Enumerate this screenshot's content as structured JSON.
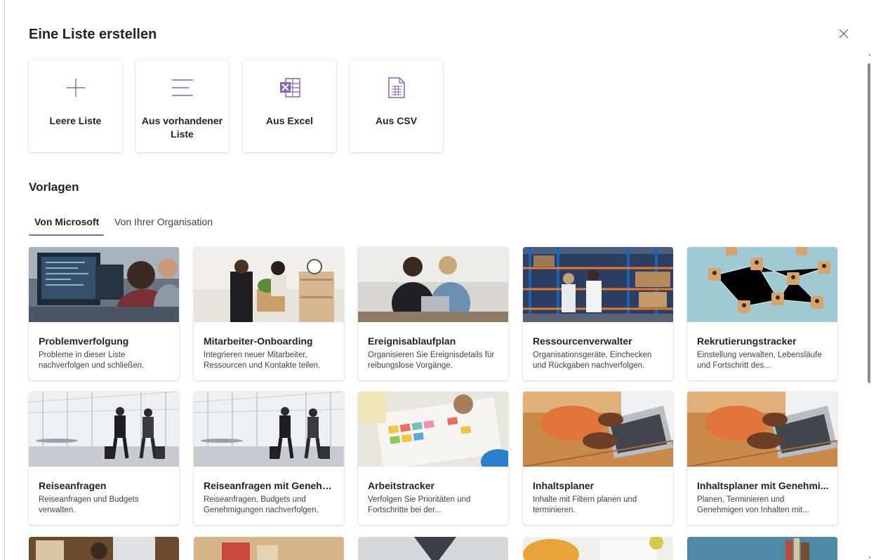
{
  "dialog": {
    "title": "Eine Liste erstellen",
    "close_icon": "close-icon"
  },
  "create_options": [
    {
      "label": "Leere Liste",
      "icon": "plus-icon"
    },
    {
      "label": "Aus vorhandener Liste",
      "icon": "list-lines-icon"
    },
    {
      "label": "Aus Excel",
      "icon": "excel-icon"
    },
    {
      "label": "Aus CSV",
      "icon": "csv-file-icon"
    }
  ],
  "templates": {
    "title": "Vorlagen",
    "tabs": [
      {
        "label": "Von Microsoft",
        "active": true
      },
      {
        "label": "Von Ihrer Organisation",
        "active": false
      }
    ],
    "cards": [
      {
        "title": "Problemverfolgung",
        "desc": "Probleme in dieser Liste nachverfolgen und schließen.",
        "image": "office-desk-monitors-photo"
      },
      {
        "title": "Mitarbeiter-Onboarding",
        "desc": "Integrieren neuer Mitarbeiter, Ressourcen und Kontakte teilen.",
        "image": "handshake-new-employee-photo"
      },
      {
        "title": "Ereignisablaufplan",
        "desc": "Organisieren Sie Ereignisdetails für reibungslose Vorgänge.",
        "image": "two-women-laptop-photo"
      },
      {
        "title": "Ressourcenverwalter",
        "desc": "Organisationsgeräte, Einchecken und Rückgaben nachverfolgen.",
        "image": "warehouse-shelves-photo"
      },
      {
        "title": "Rekrutierungstracker",
        "desc": "Einstellung verwalten, Lebensläufe und Fortschritt des...",
        "image": "network-blocks-photo"
      },
      {
        "title": "Reiseanfragen",
        "desc": "Reiseanfragen und Budgets verwalten.",
        "image": "airport-travelers-photo"
      },
      {
        "title": "Reiseanfragen mit Genehm...",
        "desc": "Reiseanfragen, Budgets und Genehmigungen nachverfolgen.",
        "image": "airport-travelers-photo"
      },
      {
        "title": "Arbeitstracker",
        "desc": "Verfolgen Sie Prioritäten und Fortschritte bei der...",
        "image": "sticky-notes-chart-photo"
      },
      {
        "title": "Inhaltsplaner",
        "desc": "Inhalte mit Filtern planen und terminieren.",
        "image": "hands-laptop-photo"
      },
      {
        "title": "Inhaltsplaner mit Genehmi...",
        "desc": "Planen, Terminieren und Genehmigen von Inhalten mit...",
        "image": "hands-laptop-photo"
      }
    ]
  },
  "colors": {
    "accent": "#8764b8",
    "excel": "#8764b8",
    "text": "#242424"
  }
}
